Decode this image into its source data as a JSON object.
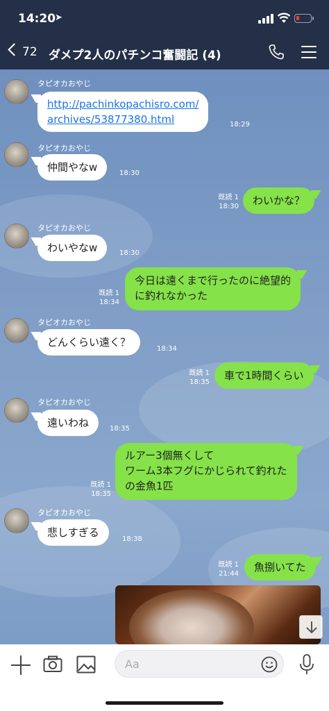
{
  "status": {
    "time": "14:20",
    "battery_color": "#ff3b30"
  },
  "nav": {
    "back_count": "72",
    "title": "ダメプ2人のパチンコ奮闘記 (4)"
  },
  "messages": [
    {
      "type": "in",
      "sender": "タピオカおやじ",
      "link_line1": "http://pachinkopachisro.com/",
      "link_line2": "archives/53877380.html",
      "time": "18:29"
    },
    {
      "type": "in",
      "sender": "タピオカおやじ",
      "text": "仲間やなw",
      "time": "18:30"
    },
    {
      "type": "out",
      "read": "既読 1",
      "text": "わいかな？",
      "time": "18:30"
    },
    {
      "type": "in",
      "sender": "タピオカおやじ",
      "text": "わいやなw",
      "time": "18:30"
    },
    {
      "type": "out",
      "read": "既読 1",
      "line1": "今日は遠くまで行ったのに絶望的",
      "line2": "に釣れなかった",
      "time": "18:34"
    },
    {
      "type": "in",
      "sender": "タピオカおやじ",
      "text": "どんくらい遠く？",
      "time": "18:34"
    },
    {
      "type": "out",
      "read": "既読 1",
      "text": "車で1時間くらい",
      "time": "18:35"
    },
    {
      "type": "in",
      "sender": "タピオカおやじ",
      "text": "遠いわね",
      "time": "18:35"
    },
    {
      "type": "out",
      "read": "既読 1",
      "line1": "ルアー3個無くして",
      "line2": "ワーム3本フグにかじられて釣れた",
      "line3": "の金魚1匹",
      "time": "18:35"
    },
    {
      "type": "in",
      "sender": "タピオカおやじ",
      "text": "悲しすぎる",
      "time": "18:38"
    },
    {
      "type": "out",
      "read": "既読 1",
      "text": "魚捌いてた",
      "time": "21:44"
    }
  ],
  "input": {
    "placeholder": "Aa"
  },
  "colors": {
    "header": "#243047",
    "out_bubble": "#85e249",
    "in_bubble": "#ffffff",
    "link": "#1a73e8"
  }
}
